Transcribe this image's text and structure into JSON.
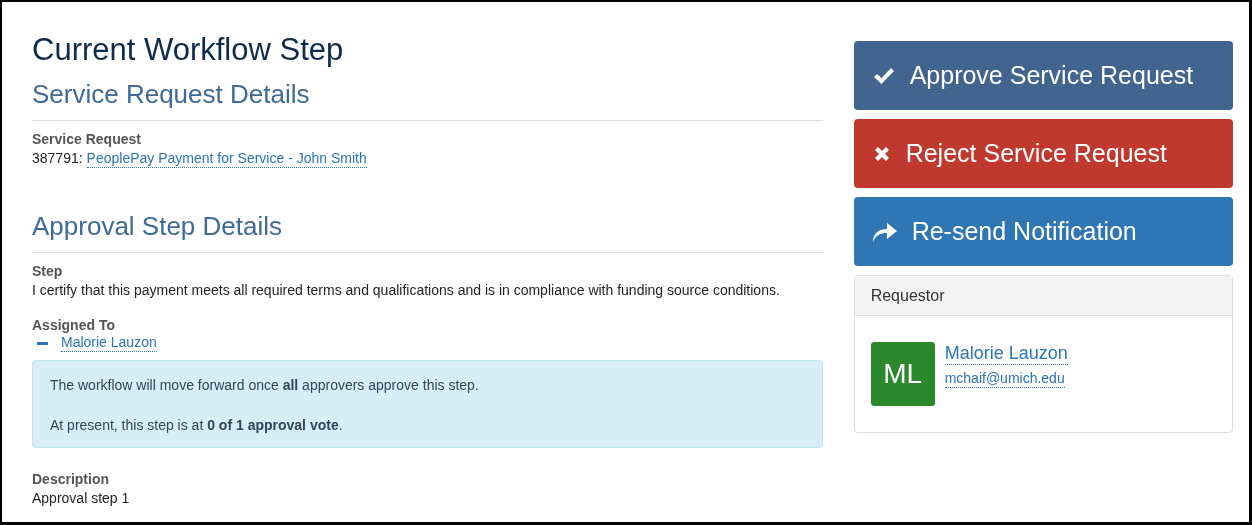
{
  "page": {
    "title": "Current Workflow Step"
  },
  "service_request_section": {
    "heading": "Service Request Details",
    "label": "Service Request",
    "id": "387791:",
    "link": "PeoplePay Payment for Service - John Smith"
  },
  "approval_section": {
    "heading": "Approval Step Details",
    "step": {
      "label": "Step",
      "text": "I certify that this payment meets all required terms and qualifications and is in compliance with funding source conditions."
    },
    "assigned_to": {
      "label": "Assigned To",
      "people": [
        {
          "name": "Malorie Lauzon"
        }
      ]
    },
    "info_box": [
      "The workflow will move forward once **all** approvers approve this step.",
      "At present, this step is at **0 of 1 approval vote**."
    ],
    "description": {
      "label": "Description",
      "text": "Approval step 1"
    }
  },
  "actions": [
    {
      "kind": "approve",
      "label": "Approve Service Request"
    },
    {
      "kind": "reject",
      "label": "Reject Service Request"
    },
    {
      "kind": "resend",
      "label": "Re-send Notification"
    }
  ],
  "requestor": {
    "heading": "Requestor",
    "initials": "ML",
    "color": "#2c882c",
    "name": "Malorie Lauzon",
    "email": "mchaif@umich.edu"
  }
}
